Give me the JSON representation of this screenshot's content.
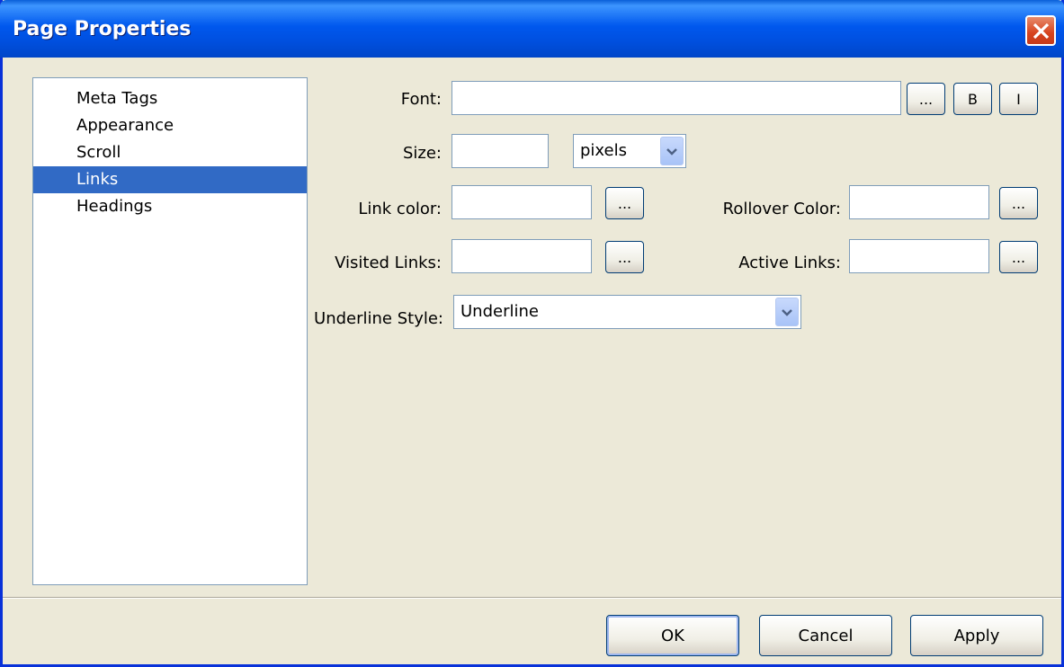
{
  "window": {
    "title": "Page Properties"
  },
  "categories": [
    {
      "label": "Meta Tags",
      "selected": false
    },
    {
      "label": "Appearance",
      "selected": false
    },
    {
      "label": "Scroll",
      "selected": false
    },
    {
      "label": "Links",
      "selected": true
    },
    {
      "label": "Headings",
      "selected": false
    }
  ],
  "form": {
    "font_label": "Font:",
    "font_value": "",
    "browse_label": "...",
    "bold_label": "B",
    "italic_label": "I",
    "size_label": "Size:",
    "size_value": "",
    "size_unit": "pixels",
    "link_color_label": "Link color:",
    "link_color_value": "",
    "rollover_color_label": "Rollover Color:",
    "rollover_color_value": "",
    "visited_links_label": "Visited Links:",
    "visited_links_value": "",
    "active_links_label": "Active Links:",
    "active_links_value": "",
    "underline_style_label": "Underline Style:",
    "underline_style_value": "Underline"
  },
  "footer": {
    "ok_label": "OK",
    "cancel_label": "Cancel",
    "apply_label": "Apply"
  },
  "colors": {
    "titlebar": "#0058ee",
    "selection": "#316ac5",
    "dialog_bg": "#ece9d8",
    "close_button": "#d7431d"
  }
}
